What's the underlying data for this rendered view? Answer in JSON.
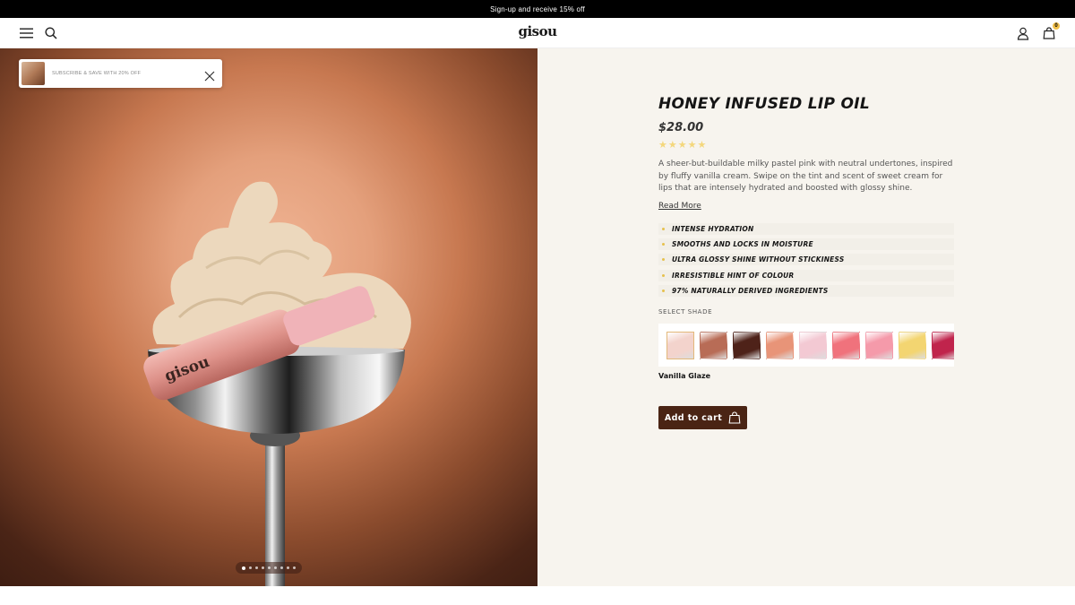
{
  "announcement": {
    "text": "Sign-up and receive 15% off"
  },
  "header": {
    "logo": "gisou",
    "cart_count": "0"
  },
  "promo": {
    "text": "SUBSCRIBE & SAVE WITH 20% OFF"
  },
  "hero": {
    "bottle_brand": "gisou",
    "slide_count": 9,
    "active_slide": 1
  },
  "product": {
    "title": "HONEY INFUSED LIP OIL",
    "price": "$28.00",
    "rating": {
      "stars": 5,
      "max": 5
    },
    "description": "A sheer-but-buildable milky pastel pink with neutral undertones, inspired by fluffy vanilla cream. Swipe on the tint and scent of sweet cream for lips that are intensely hydrated and boosted with glossy shine.",
    "read_more": "Read More",
    "benefits": [
      "INTENSE HYDRATION",
      "SMOOTHS AND LOCKS IN MOISTURE",
      "ULTRA GLOSSY SHINE WITHOUT STICKINESS",
      "IRRESISTIBLE HINT OF COLOUR",
      "97% NATURALLY DERIVED INGREDIENTS"
    ],
    "select_shade_label": "SELECT SHADE",
    "selected_shade": "Vanilla Glaze",
    "shades": [
      {
        "color": "#f3d3cc",
        "selected": true
      },
      {
        "color": "#b86c56",
        "selected": false
      },
      {
        "color": "#4e2219",
        "selected": false
      },
      {
        "color": "#e89478",
        "selected": false
      },
      {
        "color": "#f3c9d3",
        "selected": false
      },
      {
        "color": "#f0727c",
        "selected": false
      },
      {
        "color": "#f59aaa",
        "selected": false
      },
      {
        "color": "#f3d571",
        "selected": false
      },
      {
        "color": "#c0244c",
        "selected": false
      }
    ],
    "add_to_cart": "Add to cart"
  },
  "colors": {
    "accent": "#4a2414",
    "star": "#f4d77c",
    "panel_bg": "#f7f4ee"
  }
}
